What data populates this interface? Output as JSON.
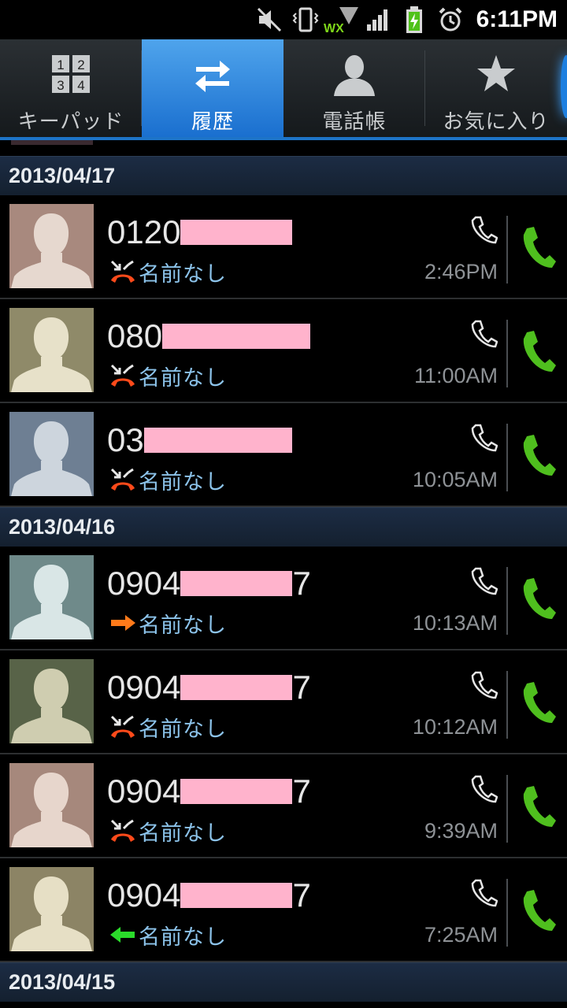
{
  "status_bar": {
    "time": "6:11PM",
    "icons": [
      "mute-icon",
      "vibrate-icon",
      "wifi-icon",
      "signal-icon",
      "battery-charging-icon",
      "alarm-icon"
    ],
    "wifi_label": "WX"
  },
  "tabs": [
    {
      "label": "キーパッド",
      "icon": "keypad-icon",
      "active": false
    },
    {
      "label": "履歴",
      "icon": "history-icon",
      "active": true
    },
    {
      "label": "電話帳",
      "icon": "contacts-icon",
      "active": false
    },
    {
      "label": "お気に入り",
      "icon": "favorites-icon",
      "active": false
    }
  ],
  "keypad_digits": [
    "1",
    "2",
    "3",
    "4"
  ],
  "groups": [
    {
      "date": "2013/04/17",
      "calls": [
        {
          "prefix": "0120",
          "suffix": "",
          "name": "名前なし",
          "type": "missed",
          "time": "2:46PM",
          "avatar_bg": "#a8897e",
          "avatar_fg": "#e6d8cf"
        },
        {
          "prefix": "080",
          "suffix": "",
          "name": "名前なし",
          "type": "missed",
          "time": "11:00AM",
          "avatar_bg": "#8f8a69",
          "avatar_fg": "#e7e1c9"
        },
        {
          "prefix": "03",
          "suffix": "",
          "name": "名前なし",
          "type": "missed",
          "time": "10:05AM",
          "avatar_bg": "#6e7f93",
          "avatar_fg": "#cdd5dd"
        }
      ]
    },
    {
      "date": "2013/04/16",
      "calls": [
        {
          "prefix": "0904",
          "suffix": "7",
          "name": "名前なし",
          "type": "outgoing",
          "time": "10:13AM",
          "avatar_bg": "#6f8a8a",
          "avatar_fg": "#d9e6e6"
        },
        {
          "prefix": "0904",
          "suffix": "7",
          "name": "名前なし",
          "type": "missed",
          "time": "10:12AM",
          "avatar_bg": "#586348",
          "avatar_fg": "#cfcdb0"
        },
        {
          "prefix": "0904",
          "suffix": "7",
          "name": "名前なし",
          "type": "missed",
          "time": "9:39AM",
          "avatar_bg": "#a6887c",
          "avatar_fg": "#e7d6cc"
        },
        {
          "prefix": "0904",
          "suffix": "7",
          "name": "名前なし",
          "type": "incoming",
          "time": "7:25AM",
          "avatar_bg": "#8c8465",
          "avatar_fg": "#e6dfc5"
        }
      ]
    },
    {
      "date": "2013/04/15",
      "calls": []
    }
  ],
  "colors": {
    "missed": "#ff4a1a",
    "outgoing": "#ff7a1a",
    "incoming": "#2bdc2b",
    "call_button": "#4fbf1e",
    "name_text": "#8cc3ea",
    "mask": "#ffb3cc"
  }
}
